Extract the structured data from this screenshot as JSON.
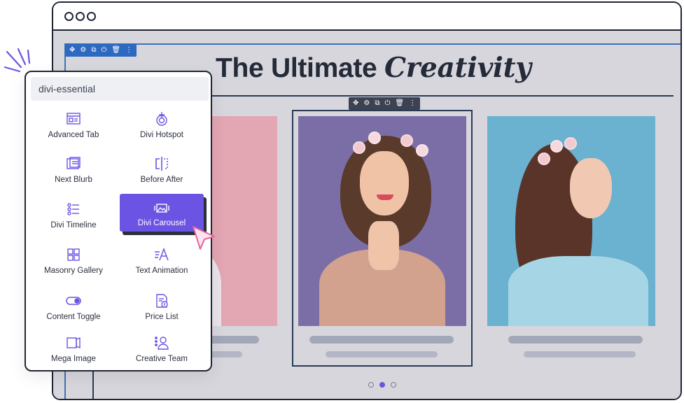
{
  "colors": {
    "accent": "#6b54e3",
    "selection_blue": "#2c69c0",
    "text_dark": "#242a38",
    "canvas": "#d7d6dd"
  },
  "headline": {
    "plain": "The Ultimate",
    "italic": "Creativity"
  },
  "section_toolbar_icons": [
    "move-icon",
    "gear-icon",
    "duplicate-icon",
    "power-icon",
    "trash-icon",
    "more-icon"
  ],
  "module_toolbar_icons": [
    "move-icon",
    "gear-icon",
    "duplicate-icon",
    "power-icon",
    "trash-icon",
    "more-icon"
  ],
  "panel": {
    "search_value": "divi-essential",
    "modules": [
      {
        "label": "Advanced Tab",
        "icon": "tabs-icon"
      },
      {
        "label": "Divi Hotspot",
        "icon": "hotspot-icon"
      },
      {
        "label": "Next Blurb",
        "icon": "blurb-icon"
      },
      {
        "label": "Before After",
        "icon": "before-after-icon"
      },
      {
        "label": "Divi Timeline",
        "icon": "timeline-icon"
      },
      {
        "label": "Divi Carousel",
        "icon": "carousel-icon",
        "selected": true
      },
      {
        "label": "Masonry Gallery",
        "icon": "gallery-icon"
      },
      {
        "label": "Text Animation",
        "icon": "text-animation-icon"
      },
      {
        "label": "Content Toggle",
        "icon": "toggle-icon"
      },
      {
        "label": "Price List",
        "icon": "price-list-icon"
      },
      {
        "label": "Mega Image",
        "icon": "mega-image-icon"
      },
      {
        "label": "Creative Team",
        "icon": "team-icon"
      }
    ]
  },
  "carousel": {
    "slides": 3,
    "active_slide": 2
  }
}
